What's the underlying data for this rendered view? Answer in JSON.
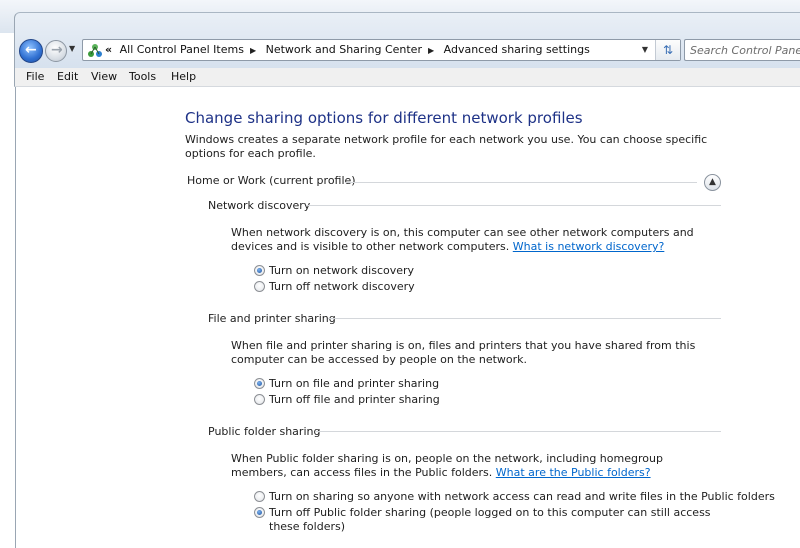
{
  "address": {
    "crumbs": [
      "All Control Panel Items",
      "Network and Sharing Center",
      "Advanced sharing settings"
    ],
    "overflow": "«"
  },
  "search": {
    "placeholder": "Search Control Panel"
  },
  "menu": [
    "File",
    "Edit",
    "View",
    "Tools",
    "Help"
  ],
  "page": {
    "title": "Change sharing options for different network profiles",
    "description": "Windows creates a separate network profile for each network you use. You can choose specific options for each profile.",
    "profile": "Home or Work (current profile)"
  },
  "sections": {
    "discovery": {
      "heading": "Network discovery",
      "text": "When network discovery is on, this computer can see other network computers and devices and is visible to other network computers.",
      "link": "What is network discovery?",
      "options": [
        "Turn on network discovery",
        "Turn off network discovery"
      ],
      "selected": 0
    },
    "printer": {
      "heading": "File and printer sharing",
      "text": "When file and printer sharing is on, files and printers that you have shared from this computer can be accessed by people on the network.",
      "options": [
        "Turn on file and printer sharing",
        "Turn off file and printer sharing"
      ],
      "selected": 0
    },
    "public": {
      "heading": "Public folder sharing",
      "text": "When Public folder sharing is on, people on the network, including homegroup members, can access files in the Public folders.",
      "link": "What are the Public folders?",
      "options": [
        "Turn on sharing so anyone with network access can read and write files in the Public folders",
        "Turn off Public folder sharing (people logged on to this computer can still access these folders)"
      ],
      "selected": 1
    }
  }
}
